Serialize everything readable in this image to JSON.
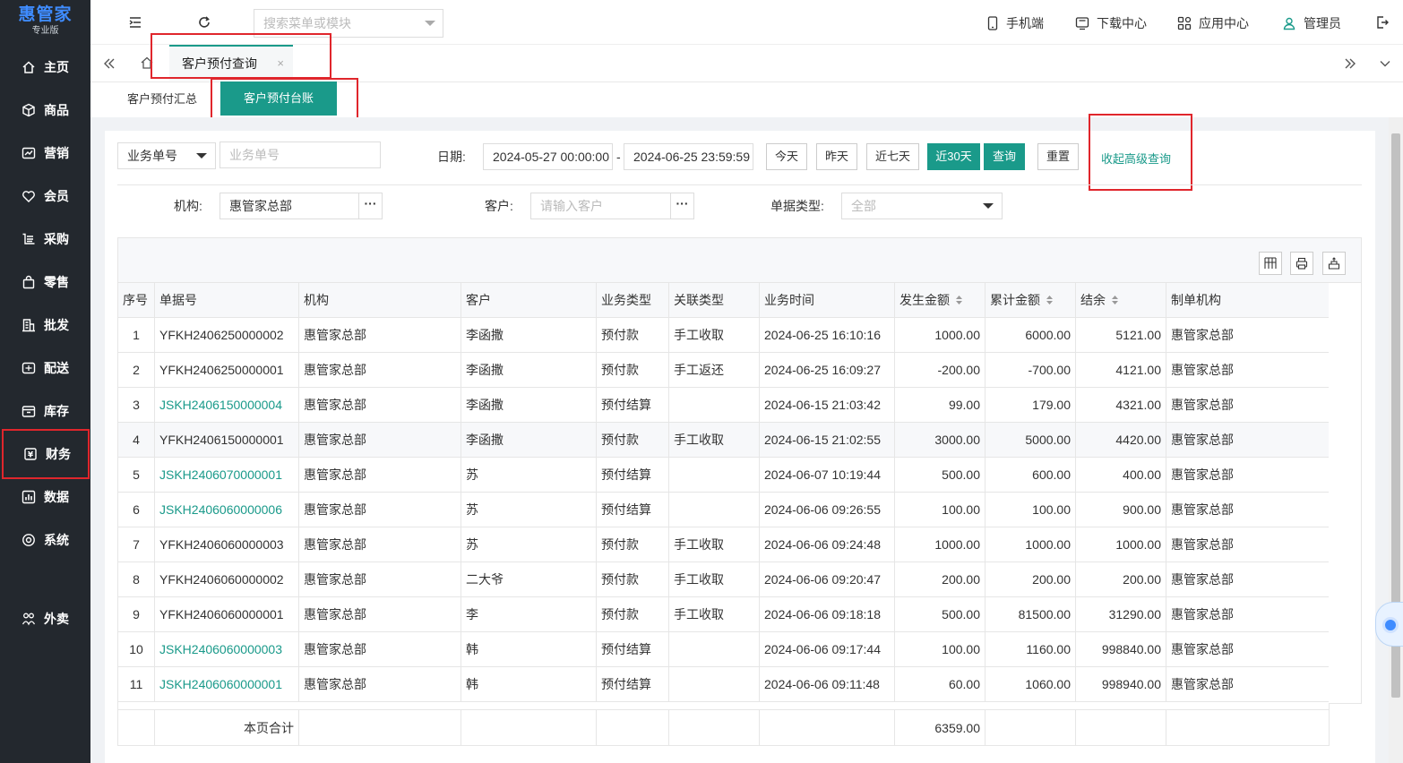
{
  "app": {
    "logo": "惠管家",
    "edition": "专业版"
  },
  "sidebar": {
    "items": [
      {
        "label": "主页",
        "icon": "home-icon"
      },
      {
        "label": "商品",
        "icon": "cube-icon"
      },
      {
        "label": "营销",
        "icon": "chart-icon"
      },
      {
        "label": "会员",
        "icon": "heart-icon"
      },
      {
        "label": "采购",
        "icon": "cart-icon"
      },
      {
        "label": "零售",
        "icon": "bag-icon"
      },
      {
        "label": "批发",
        "icon": "building-icon"
      },
      {
        "label": "配送",
        "icon": "truck-icon"
      },
      {
        "label": "库存",
        "icon": "box-icon"
      },
      {
        "label": "财务",
        "icon": "money-icon"
      },
      {
        "label": "数据",
        "icon": "data-icon"
      },
      {
        "label": "系统",
        "icon": "settings-icon"
      },
      {
        "label": "外卖",
        "icon": "delivery-icon"
      }
    ],
    "active": "财务"
  },
  "topbar": {
    "search_placeholder": "搜索菜单或模块",
    "mobile": "手机端",
    "download": "下载中心",
    "apps": "应用中心",
    "user": "管理员"
  },
  "tabs": {
    "active_tab": "客户预付查询",
    "close": "×"
  },
  "subtabs": {
    "summary": "客户预付汇总",
    "ledger": "客户预付台账"
  },
  "filters": {
    "doc_type_select": "业务单号",
    "doc_no_placeholder": "业务单号",
    "date_label": "日期:",
    "date_start": "2024-05-27 00:00:00",
    "date_sep": "-",
    "date_end": "2024-06-25 23:59:59",
    "today": "今天",
    "yesterday": "昨天",
    "last7": "近七天",
    "last30": "近30天",
    "query": "查询",
    "reset": "重置",
    "collapse_advanced": "收起高级查询",
    "org_label": "机构:",
    "org_value": "惠管家总部",
    "customer_label": "客户:",
    "customer_placeholder": "请输入客户",
    "bill_type_label": "单据类型:",
    "bill_type_value": "全部",
    "more": "···"
  },
  "table": {
    "columns": [
      "序号",
      "单据号",
      "机构",
      "客户",
      "业务类型",
      "关联类型",
      "业务时间",
      "发生金额",
      "累计金额",
      "结余",
      "制单机构"
    ],
    "rows": [
      {
        "no": "1",
        "doc": "YFKH2406250000002",
        "link": false,
        "org": "惠管家总部",
        "customer": "李函撒",
        "biz": "预付款",
        "rel": "手工收取",
        "time": "2024-06-25 16:10:16",
        "amount": "1000.00",
        "total": "6000.00",
        "balance": "5121.00",
        "maker": "惠管家总部"
      },
      {
        "no": "2",
        "doc": "YFKH2406250000001",
        "link": false,
        "org": "惠管家总部",
        "customer": "李函撒",
        "biz": "预付款",
        "rel": "手工返还",
        "time": "2024-06-25 16:09:27",
        "amount": "-200.00",
        "total": "-700.00",
        "balance": "4121.00",
        "maker": "惠管家总部"
      },
      {
        "no": "3",
        "doc": "JSKH2406150000004",
        "link": true,
        "org": "惠管家总部",
        "customer": "李函撒",
        "biz": "预付结算",
        "rel": "",
        "time": "2024-06-15 21:03:42",
        "amount": "99.00",
        "total": "179.00",
        "balance": "4321.00",
        "maker": "惠管家总部"
      },
      {
        "no": "4",
        "doc": "YFKH2406150000001",
        "link": false,
        "org": "惠管家总部",
        "customer": "李函撒",
        "biz": "预付款",
        "rel": "手工收取",
        "time": "2024-06-15 21:02:55",
        "amount": "3000.00",
        "total": "5000.00",
        "balance": "4420.00",
        "maker": "惠管家总部"
      },
      {
        "no": "5",
        "doc": "JSKH2406070000001",
        "link": true,
        "org": "惠管家总部",
        "customer": "苏",
        "biz": "预付结算",
        "rel": "",
        "time": "2024-06-07 10:19:44",
        "amount": "500.00",
        "total": "600.00",
        "balance": "400.00",
        "maker": "惠管家总部"
      },
      {
        "no": "6",
        "doc": "JSKH2406060000006",
        "link": true,
        "org": "惠管家总部",
        "customer": "苏",
        "biz": "预付结算",
        "rel": "",
        "time": "2024-06-06 09:26:55",
        "amount": "100.00",
        "total": "100.00",
        "balance": "900.00",
        "maker": "惠管家总部"
      },
      {
        "no": "7",
        "doc": "YFKH2406060000003",
        "link": false,
        "org": "惠管家总部",
        "customer": "苏",
        "biz": "预付款",
        "rel": "手工收取",
        "time": "2024-06-06 09:24:48",
        "amount": "1000.00",
        "total": "1000.00",
        "balance": "1000.00",
        "maker": "惠管家总部"
      },
      {
        "no": "8",
        "doc": "YFKH2406060000002",
        "link": false,
        "org": "惠管家总部",
        "customer": "二大爷",
        "biz": "预付款",
        "rel": "手工收取",
        "time": "2024-06-06 09:20:47",
        "amount": "200.00",
        "total": "200.00",
        "balance": "200.00",
        "maker": "惠管家总部"
      },
      {
        "no": "9",
        "doc": "YFKH2406060000001",
        "link": false,
        "org": "惠管家总部",
        "customer": "李",
        "biz": "预付款",
        "rel": "手工收取",
        "time": "2024-06-06 09:18:18",
        "amount": "500.00",
        "total": "81500.00",
        "balance": "31290.00",
        "maker": "惠管家总部"
      },
      {
        "no": "10",
        "doc": "JSKH2406060000003",
        "link": true,
        "org": "惠管家总部",
        "customer": "韩",
        "biz": "预付结算",
        "rel": "",
        "time": "2024-06-06 09:17:44",
        "amount": "100.00",
        "total": "1160.00",
        "balance": "998840.00",
        "maker": "惠管家总部"
      },
      {
        "no": "11",
        "doc": "JSKH2406060000001",
        "link": true,
        "org": "惠管家总部",
        "customer": "韩",
        "biz": "预付结算",
        "rel": "",
        "time": "2024-06-06 09:11:48",
        "amount": "60.00",
        "total": "1060.00",
        "balance": "998940.00",
        "maker": "惠管家总部"
      }
    ],
    "page_total_label": "本页合计",
    "page_total_amount": "6359.00"
  },
  "colors": {
    "accent": "#1a9a8a",
    "sidebar_bg": "#23282e",
    "highlight": "#e0262c"
  }
}
